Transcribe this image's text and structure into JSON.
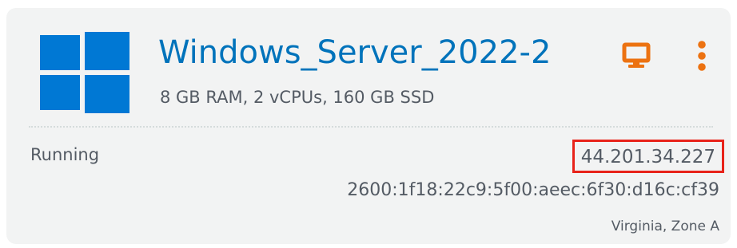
{
  "instance": {
    "name": "Windows_Server_2022-2",
    "specs": "8 GB RAM, 2 vCPUs, 160 GB SSD",
    "status": "Running",
    "public_ipv4": "44.201.34.227",
    "ipv6": "2600:1f18:22c9:5f00:aeec:6f30:d16c:cf39",
    "location": "Virginia, Zone A",
    "os_icon": "windows-logo-icon"
  },
  "actions": {
    "connect_icon": "monitor-icon",
    "menu_icon": "vertical-ellipsis-icon"
  },
  "colors": {
    "card_background": "#f2f3f3",
    "title_link": "#0073bb",
    "action_orange": "#ec7211",
    "windows_blue": "#0078d4",
    "highlight_red": "#e8231a",
    "text_secondary": "#545b64"
  }
}
